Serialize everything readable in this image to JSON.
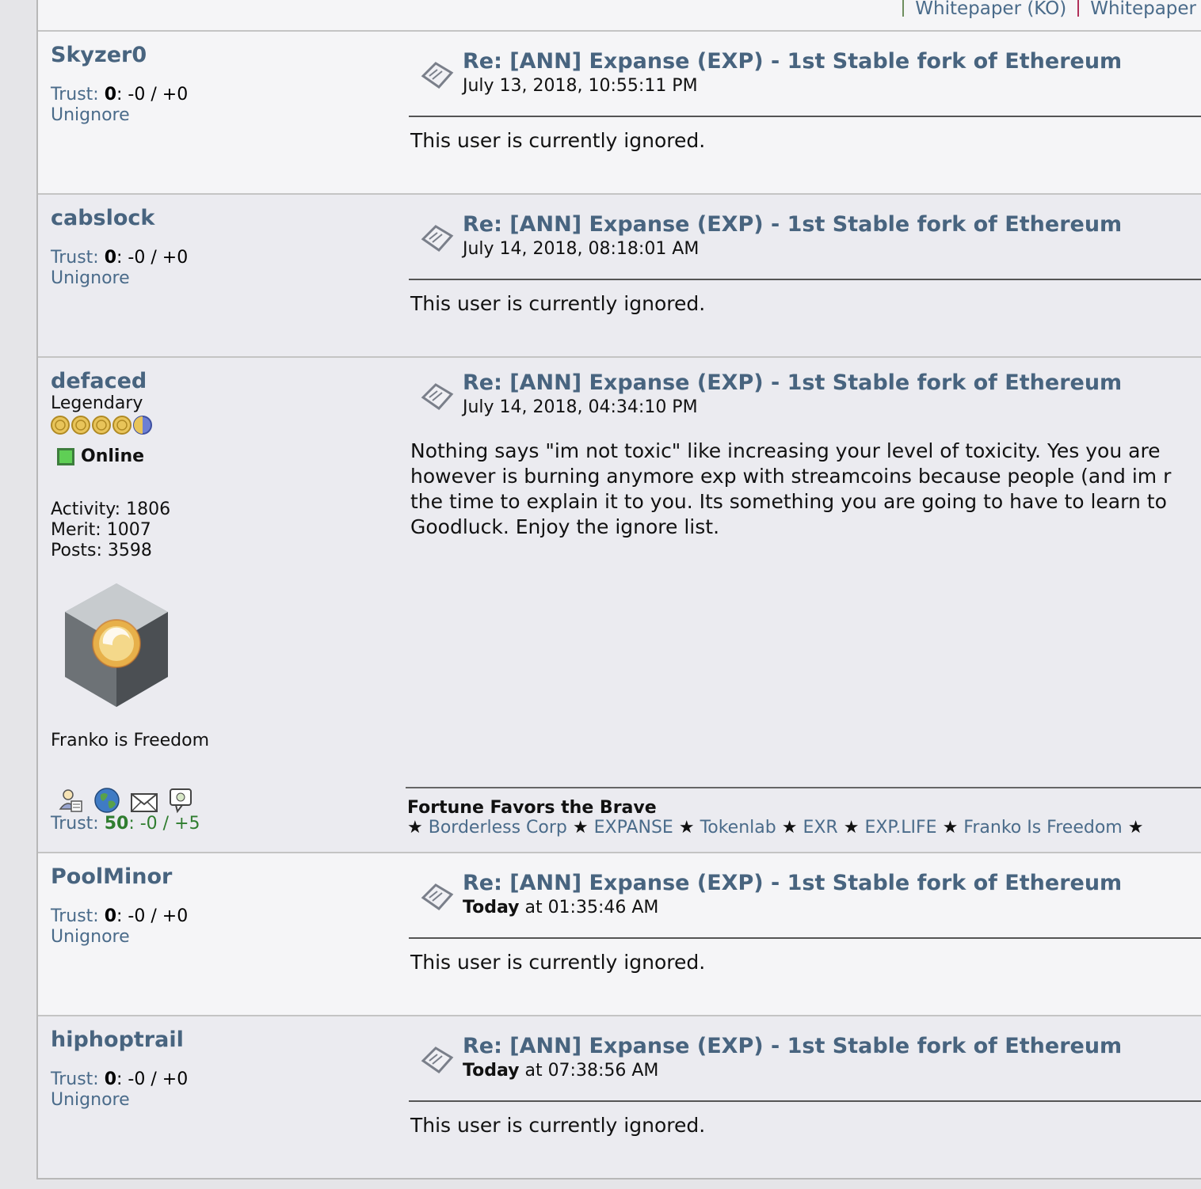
{
  "top_links": [
    {
      "label": "Whitepaper (KO)",
      "sep_color": "#6f8f5f"
    },
    {
      "label": "Whitepaper",
      "sep_color": "#b0305a"
    }
  ],
  "posts": [
    {
      "username": "Skyzer0",
      "trust_label": "Trust:",
      "trust_score": "0",
      "trust_values": ": -0 / +0",
      "unignore": "Unignore",
      "title": "Re: [ANN] Expanse (EXP) - 1st Stable fork of Ethereum",
      "date": "July 13, 2018, 10:55:11 PM",
      "body": "This user is currently ignored."
    },
    {
      "username": "cabslock",
      "trust_label": "Trust:",
      "trust_score": "0",
      "trust_values": ": -0 / +0",
      "unignore": "Unignore",
      "title": "Re: [ANN] Expanse (EXP) - 1st Stable fork of Ethereum",
      "date": "July 14, 2018, 08:18:01 AM",
      "body": "This user is currently ignored."
    },
    {
      "username": "defaced",
      "rank": "Legendary",
      "status": "Online",
      "activity": "Activity: 1806",
      "merit": "Merit: 1007",
      "posts": "Posts: 3598",
      "personal_text": "Franko is Freedom",
      "trust_label": "Trust:",
      "trust_score": "50",
      "trust_values": ": -0 / +5",
      "title": "Re: [ANN] Expanse (EXP) - 1st Stable fork of Ethereum",
      "date": "July 14, 2018, 04:34:10 PM",
      "body_lines": [
        "Nothing says \"im not toxic\" like increasing your level of toxicity. Yes you are",
        "however is burning anymore exp with streamcoins because people (and im r",
        "the time to explain it to you. Its something you are going to have to learn to",
        "Goodluck. Enjoy the ignore list."
      ],
      "signature_title": "Fortune Favors the Brave",
      "signature_links": [
        "Borderless Corp",
        "EXPANSE",
        "Tokenlab",
        "EXR",
        "EXP.LIFE",
        "Franko Is Freedom"
      ],
      "signature_star": "★"
    },
    {
      "username": "PoolMinor",
      "trust_label": "Trust:",
      "trust_score": "0",
      "trust_values": ": -0 / +0",
      "unignore": "Unignore",
      "title": "Re: [ANN] Expanse (EXP) - 1st Stable fork of Ethereum",
      "date_bold": "Today",
      "date": " at 01:35:46 AM",
      "body": "This user is currently ignored."
    },
    {
      "username": "hiphoptrail",
      "trust_label": "Trust:",
      "trust_score": "0",
      "trust_values": ": -0 / +0",
      "unignore": "Unignore",
      "title": "Re: [ANN] Expanse (EXP) - 1st Stable fork of Ethereum",
      "date_bold": "Today",
      "date": " at 07:38:56 AM",
      "body": "This user is currently ignored."
    }
  ],
  "colors": {
    "link": "#4a6b8a",
    "username": "#48647f",
    "trust_positive": "#2f7d2f",
    "online": "#5fcf55"
  }
}
